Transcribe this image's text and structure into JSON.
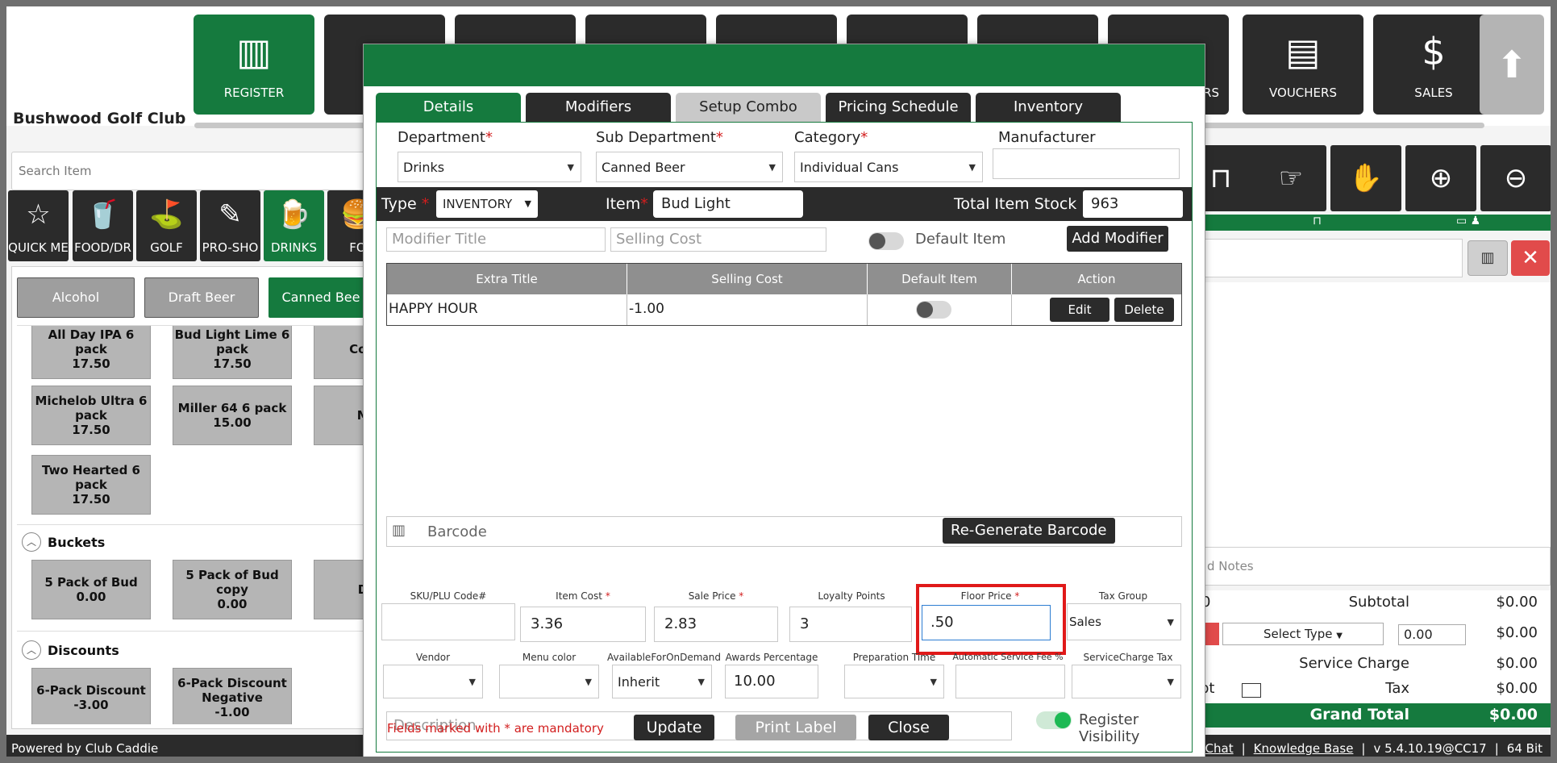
{
  "app": {
    "club_name": "Bushwood Golf Club",
    "footer_powered": "Powered by Club Caddie",
    "footer_links": [
      "Chat",
      "Knowledge Base"
    ],
    "footer_version": "v 5.4.10.19@CC17",
    "footer_bits": "64 Bit",
    "separator": "|"
  },
  "top_tiles": [
    {
      "label": "REGISTER",
      "icon": "barcode-scanner-icon",
      "glyph": "▥"
    },
    {
      "label": "RS",
      "icon": "unknown-icon",
      "glyph": ""
    },
    {
      "label": "VOUCHERS",
      "icon": "voucher-icon",
      "glyph": "▤"
    },
    {
      "label": "SALES",
      "icon": "sales-money-icon",
      "glyph": "$"
    },
    {
      "label": "",
      "icon": "arrow-up-icon",
      "glyph": "⬆"
    }
  ],
  "left": {
    "search_placeholder": "Search Item",
    "categories": [
      {
        "label": "QUICK ME",
        "glyph": "☆"
      },
      {
        "label": "FOOD/DR",
        "glyph": "🥤"
      },
      {
        "label": "GOLF",
        "glyph": "⛳"
      },
      {
        "label": "PRO-SHO",
        "glyph": "✎"
      },
      {
        "label": "DRINKS",
        "glyph": "🍺"
      },
      {
        "label": "FO",
        "glyph": "🍔"
      }
    ],
    "subcategories": [
      "Alcohol",
      "Draft Beer",
      "Canned Bee"
    ],
    "items": [
      {
        "name": "All Day IPA 6 pack",
        "price": "17.50"
      },
      {
        "name": "Bud Light Lime 6 pack",
        "price": "17.50"
      },
      {
        "name": "Corona",
        "price": ""
      },
      {
        "name": "Michelob Ultra 6 pack",
        "price": "17.50"
      },
      {
        "name": "Miller 64 6 pack",
        "price": "15.00"
      },
      {
        "name": "Mille",
        "price": ""
      },
      {
        "name": "Two Hearted 6 pack",
        "price": "17.50"
      }
    ],
    "sections": [
      {
        "title": "Buckets",
        "items": [
          {
            "name": "5 Pack of Bud",
            "price": "0.00"
          },
          {
            "name": "5 Pack of Bud copy",
            "price": "0.00"
          },
          {
            "name": "Dom",
            "price": ""
          }
        ]
      },
      {
        "title": "Discounts",
        "items": [
          {
            "name": "6-Pack Discount",
            "price": "-3.00"
          },
          {
            "name": "6-Pack Discount Negative",
            "price": "-1.00"
          }
        ]
      }
    ]
  },
  "right": {
    "notes_placeholder": "d Notes",
    "subtotal_label": "Subtotal",
    "subtotal_value": "$0.00",
    "select_type": "Select Type",
    "tip_value": "0.00",
    "tip_total": "$0.00",
    "service_label": "Service Charge",
    "service_value": "$0.00",
    "tax_label": "Tax",
    "tax_value": "$0.00",
    "tax_prefix": "pt",
    "grand_label": "Grand Total",
    "grand_value": "$0.00",
    "zero_prefix": "0"
  },
  "dialog": {
    "tabs": [
      "Details",
      "Modifiers",
      "Setup Combo",
      "Pricing Schedule",
      "Inventory Barcodes"
    ],
    "department_label": "Department",
    "department_value": "Drinks",
    "subdept_label": "Sub Department",
    "subdept_value": "Canned Beer",
    "category_label": "Category",
    "category_value": "Individual Cans",
    "manufacturer_label": "Manufacturer",
    "manufacturer_value": "",
    "type_label": "Type",
    "type_value": "INVENTORY",
    "item_label": "Item",
    "item_value": "Bud Light",
    "stock_label": "Total Item Stock",
    "stock_value": "963",
    "modifier_title_placeholder": "Modifier Title",
    "selling_cost_placeholder": "Selling Cost",
    "default_item_label": "Default Item",
    "add_modifier_label": "Add Modifier",
    "table_headers": [
      "Extra Title",
      "Selling Cost",
      "Default Item",
      "Action"
    ],
    "table_rows": [
      {
        "title": "HAPPY HOUR",
        "cost": "-1.00",
        "edit": "Edit",
        "delete": "Delete"
      }
    ],
    "barcode_label": "Barcode",
    "regen_label": "Re-Generate Barcode",
    "sku_label": "SKU/PLU Code#",
    "sku_value": "",
    "item_cost_label": "Item Cost",
    "item_cost_value": "3.36",
    "sale_price_label": "Sale Price",
    "sale_price_value": "2.83",
    "loyalty_label": "Loyalty Points",
    "loyalty_value": "3",
    "floor_price_label": "Floor Price",
    "floor_price_value": ".50",
    "tax_group_label": "Tax Group",
    "tax_group_value": "Sales",
    "vendor_label": "Vendor",
    "menu_color_label": "Menu color",
    "available_label": "AvailableForOnDemand",
    "available_value": "Inherit",
    "awards_label": "Awards Percentage",
    "awards_value": "10.00",
    "prep_time_label": "Preparation Time",
    "auto_fee_label": "Automatic Service Fee %",
    "sc_tax_label": "ServiceCharge Tax Group",
    "description_placeholder": "Description",
    "register_visibility_label": "Register Visibility",
    "mandatory_note": "Fields marked with * are mandatory",
    "update_label": "Update",
    "print_label": "Print Label",
    "close_label": "Close",
    "required_mark": "*"
  }
}
